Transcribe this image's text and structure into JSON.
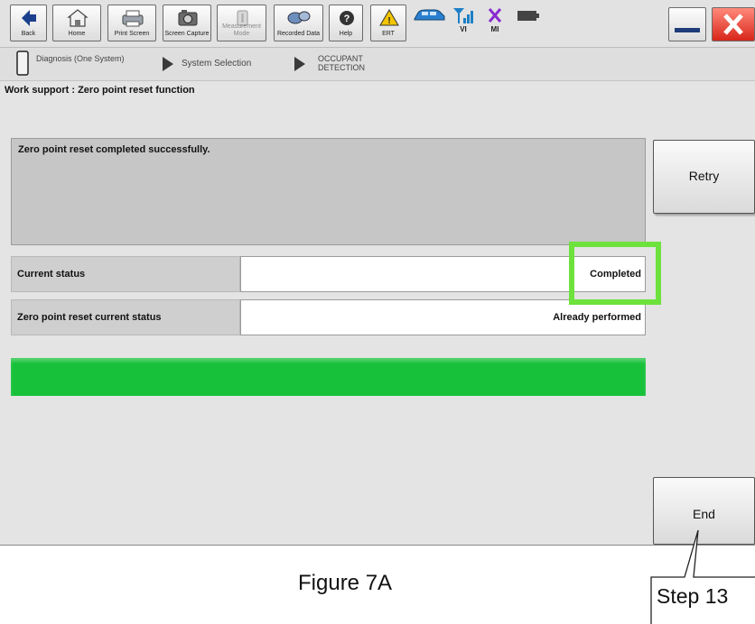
{
  "toolbar": {
    "buttons": [
      {
        "label": "Back"
      },
      {
        "label": "Home"
      },
      {
        "label": "Print Screen"
      },
      {
        "label": "Screen Capture"
      },
      {
        "label": "Measurement Mode"
      },
      {
        "label": "Recorded Data"
      },
      {
        "label": "Help"
      },
      {
        "label": "ERT"
      }
    ],
    "status": [
      {
        "label": "VI"
      },
      {
        "label": "MI"
      }
    ]
  },
  "breadcrumb": {
    "items": [
      {
        "label": "Diagnosis (One System)"
      },
      {
        "label": "System Selection"
      },
      {
        "label": "OCCUPANT DETECTION"
      }
    ]
  },
  "page": {
    "title": "Work support : Zero point reset function",
    "message": "Zero point reset completed successfully."
  },
  "rows": [
    {
      "label": "Current status",
      "value": "Completed"
    },
    {
      "label": "Zero point reset current status",
      "value": "Already performed"
    }
  ],
  "progress": {
    "fraction": 1.0,
    "color": "#17c13a"
  },
  "buttons": {
    "retry": "Retry",
    "end": "End"
  },
  "annotation": {
    "caption": "Figure 7A",
    "step": "Step 13",
    "highlight_color": "#6ee23c"
  }
}
